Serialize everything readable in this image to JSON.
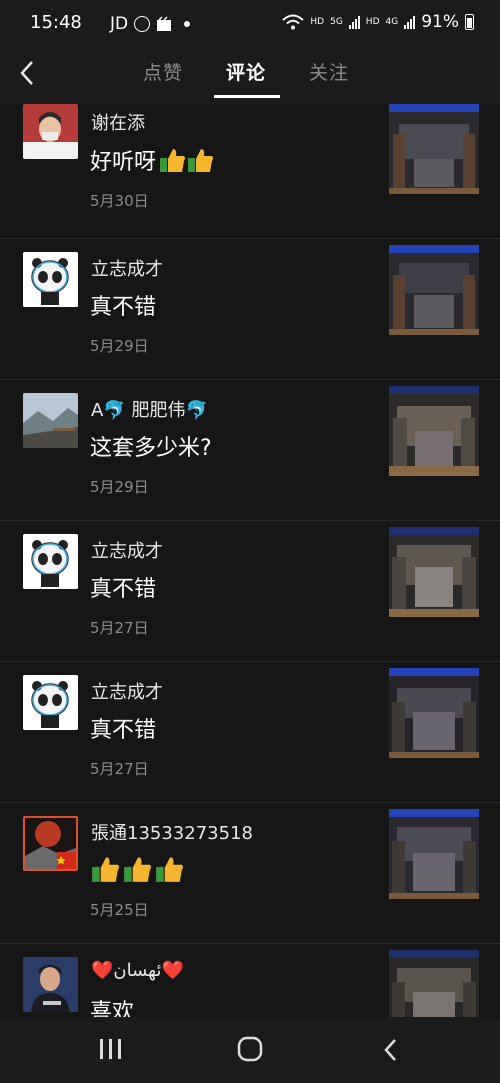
{
  "status_bar": {
    "time": "15:48",
    "carrier_label": "JD",
    "signal_labels": [
      "HD",
      "5G",
      "HD",
      "4G"
    ],
    "battery": "91%"
  },
  "header": {
    "tabs": [
      {
        "label": "点赞",
        "active": false
      },
      {
        "label": "评论",
        "active": true
      },
      {
        "label": "关注",
        "active": false
      }
    ]
  },
  "comments": [
    {
      "username": "谢在添",
      "text": "好听呀",
      "emoji": [
        "thumbs-up",
        "thumbs-up"
      ],
      "date": "5月30日",
      "avatar": "person-avatar"
    },
    {
      "username": "立志成才",
      "text": "真不错",
      "date": "5月29日",
      "avatar": "panda-mascot-avatar"
    },
    {
      "username": "A🐬 肥肥伟🐬",
      "text": "这套多少米?",
      "date": "5月29日",
      "avatar": "mountain-landscape-avatar"
    },
    {
      "username": "立志成才",
      "text": "真不错",
      "date": "5月27日",
      "avatar": "panda-mascot-avatar"
    },
    {
      "username": "立志成才",
      "text": "真不错",
      "date": "5月27日",
      "avatar": "panda-mascot-avatar"
    },
    {
      "username": "張通13533273518",
      "text": "",
      "emoji": [
        "thumbs-up",
        "thumbs-up",
        "thumbs-up"
      ],
      "date": "5月25日",
      "avatar": "moon-flag-avatar"
    },
    {
      "username": "❤️ئهسان❤️",
      "text": "喜欢",
      "date": "",
      "avatar": "man-portrait-avatar"
    }
  ],
  "colors": {
    "background": "#161616",
    "bar": "#1b1b1b",
    "date_text": "#8c8c8c",
    "inactive_tab": "#8a8a8a"
  }
}
